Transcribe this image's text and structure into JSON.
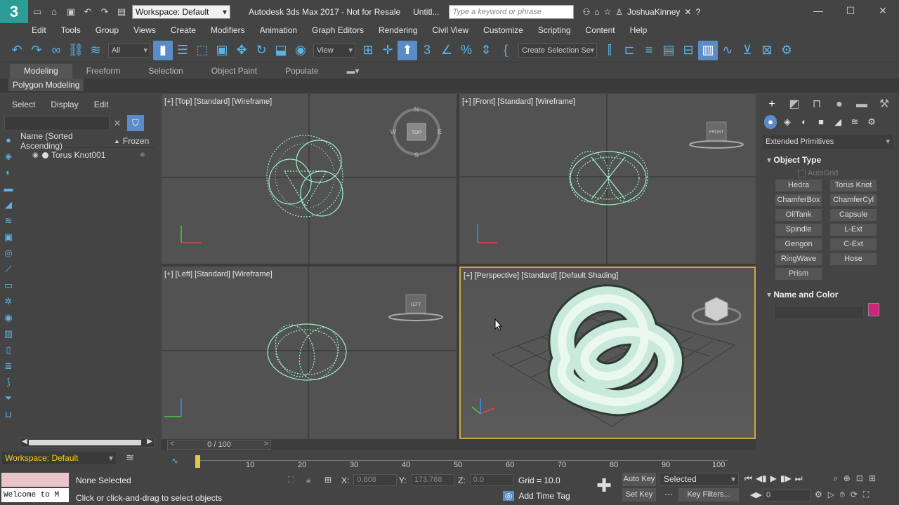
{
  "title_bar": {
    "logo": "3",
    "workspace": "Workspace: Default",
    "app_title": "Autodesk 3ds Max 2017 - Not for Resale",
    "doc_title": "Untitl...",
    "search_placeholder": "Type a keyword or phrase",
    "user": "JoshuaKinney"
  },
  "menu": [
    "Edit",
    "Tools",
    "Group",
    "Views",
    "Create",
    "Modifiers",
    "Animation",
    "Graph Editors",
    "Rendering",
    "Civil View",
    "Customize",
    "Scripting",
    "Content",
    "Help"
  ],
  "toolbar": {
    "filter_dropdown": "All",
    "ref_coord_dropdown": "View",
    "selection_set_dropdown": "Create Selection Se"
  },
  "ribbon": {
    "tabs": [
      "Modeling",
      "Freeform",
      "Selection",
      "Object Paint",
      "Populate"
    ],
    "active_tab": "Modeling",
    "sub_panel": "Polygon Modeling"
  },
  "scene_explorer": {
    "menus": [
      "Select",
      "Display",
      "Edit"
    ],
    "col_name": "Name (Sorted Ascending)",
    "col_frozen": "Frozen",
    "sort_arrow": "▲",
    "rows": [
      {
        "name": "Torus Knot001"
      }
    ]
  },
  "viewports": {
    "top": "[+] [Top] [Standard] [Wireframe]",
    "front": "[+] [Front] [Standard] [Wireframe]",
    "left": "[+] [Left] [Standard] [Wireframe]",
    "perspective": "[+] [Perspective] [Standard] [Default Shading]",
    "compass": {
      "n": "N",
      "s": "S",
      "e": "E",
      "w": "W"
    },
    "viewcube_top": "TOP",
    "viewcube_front": "FRONT",
    "viewcube_left": "LEFT"
  },
  "time_slider": {
    "label": "0 / 100",
    "prev": "<",
    "next": ">"
  },
  "trackbar_ticks": [
    "10",
    "20",
    "30",
    "40",
    "50",
    "60",
    "70",
    "80",
    "90",
    "100"
  ],
  "workspace_bottom": "Workspace: Default",
  "status": {
    "maxscript_line": "Welcome to M",
    "selection": "None Selected",
    "prompt": "Click or click-and-drag to select objects",
    "x_label": "X:",
    "x_value": "0.808",
    "y_label": "Y:",
    "y_value": "173.788",
    "z_label": "Z:",
    "z_value": "0.0",
    "grid": "Grid = 10.0",
    "add_time_tag": "Add Time Tag",
    "auto_key": "Auto Key",
    "set_key": "Set Key",
    "key_mode": "Selected",
    "key_filters": "Key Filters...",
    "frame": "0"
  },
  "command_panel": {
    "category": "Extended Primitives",
    "object_type_title": "Object Type",
    "autogrid": "AutoGrid",
    "buttons": [
      "Hedra",
      "Torus Knot",
      "ChamferBox",
      "ChamferCyl",
      "OilTank",
      "Capsule",
      "Spindle",
      "L-Ext",
      "Gengon",
      "C-Ext",
      "RingWave",
      "Hose",
      "Prism"
    ],
    "name_color_title": "Name and Color",
    "color": "#d1227a"
  },
  "colors": {
    "accent": "#5a8dc8",
    "wire": "#9ef0c8",
    "active_viewport_border": "#c8a93e",
    "workspace_text": "#f2cc1d"
  }
}
